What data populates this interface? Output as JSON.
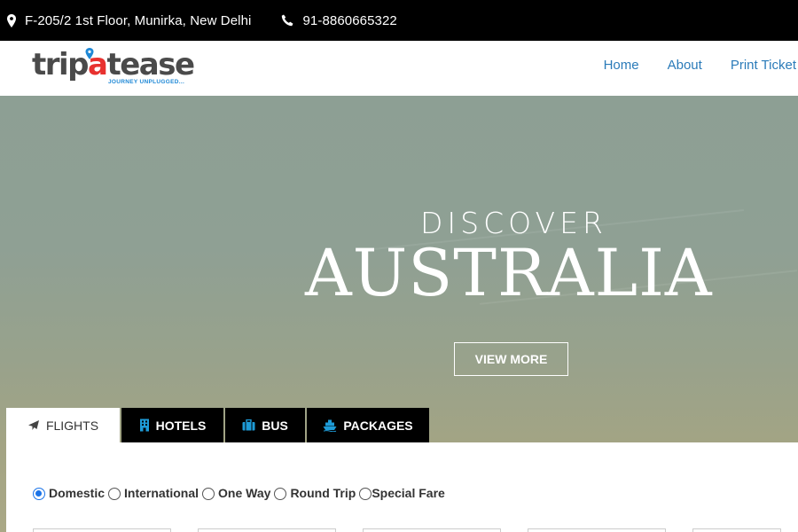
{
  "topbar": {
    "address": "F-205/2 1st Floor, Munirka, New Delhi",
    "phone": "91-8860665322"
  },
  "brand": {
    "logo_part1": "trip",
    "logo_part2": "a",
    "logo_part3": "tease",
    "tagline": "JOURNEY UNPLUGGED..."
  },
  "nav": {
    "items": [
      "Home",
      "About",
      "Print Ticket"
    ]
  },
  "hero": {
    "kicker": "DISCOVER",
    "title": "AUSTRALIA",
    "cta": "VIEW MORE"
  },
  "tabs": [
    {
      "label": "FLIGHTS",
      "icon": "plane-icon",
      "active": true
    },
    {
      "label": "HOTELS",
      "icon": "building-icon",
      "active": false
    },
    {
      "label": "BUS",
      "icon": "briefcase-icon",
      "active": false
    },
    {
      "label": "PACKAGES",
      "icon": "ship-icon",
      "active": false
    }
  ],
  "trip_options": [
    {
      "label": "Domestic",
      "selected": true
    },
    {
      "label": "International",
      "selected": false
    },
    {
      "label": "One Way",
      "selected": false
    },
    {
      "label": "Round Trip",
      "selected": false
    },
    {
      "label": "Special Fare",
      "selected": false
    }
  ],
  "colors": {
    "nav_link": "#2b7bb9",
    "logo_red": "#e8312f",
    "logo_blue": "#1e88d6",
    "radio_selected": "#1a73e8",
    "tab_bg": "#000000"
  }
}
